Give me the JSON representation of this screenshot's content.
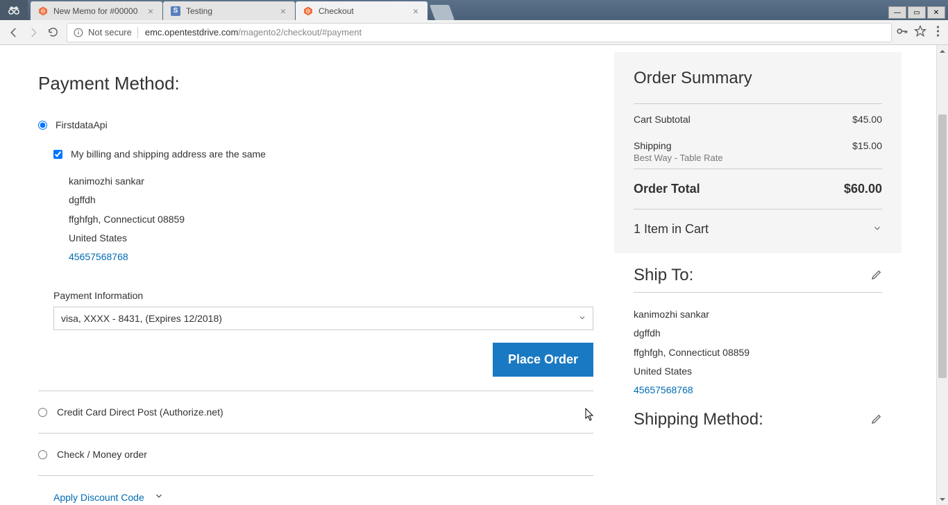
{
  "browser": {
    "tabs": [
      {
        "title": "New Memo for #00000",
        "favicon": "magento"
      },
      {
        "title": "Testing",
        "favicon": "s"
      },
      {
        "title": "Checkout",
        "favicon": "magento",
        "active": true
      }
    ],
    "security_label": "Not secure",
    "url_host": "emc.opentestdrive.com",
    "url_path": "/magento2/checkout/#payment"
  },
  "page": {
    "title": "Payment Method:",
    "methods": {
      "firstdata_label": "FirstdataApi",
      "ccdirect_label": "Credit Card Direct Post (Authorize.net)",
      "check_label": "Check / Money order"
    },
    "same_address_label": "My billing and shipping address are the same",
    "billing_address": {
      "name": "kanimozhi sankar",
      "line1": "dgffdh",
      "line2": "ffghfgh, Connecticut 08859",
      "country": "United States",
      "phone": "45657568768"
    },
    "payment_info_label": "Payment Information",
    "card_select_value": "visa, XXXX - 8431, (Expires 12/2018)",
    "place_order_label": "Place Order",
    "discount_label": "Apply Discount Code"
  },
  "summary": {
    "title": "Order Summary",
    "subtotal_label": "Cart Subtotal",
    "subtotal_value": "$45.00",
    "shipping_label": "Shipping",
    "shipping_value": "$15.00",
    "shipping_method_sub": "Best Way - Table Rate",
    "total_label": "Order Total",
    "total_value": "$60.00",
    "items_label": "1 Item in Cart"
  },
  "ship_to": {
    "title": "Ship To:",
    "name": "kanimozhi sankar",
    "line1": "dgffdh",
    "line2": "ffghfgh, Connecticut 08859",
    "country": "United States",
    "phone": "45657568768"
  },
  "shipping_method_section": {
    "title": "Shipping Method:"
  }
}
